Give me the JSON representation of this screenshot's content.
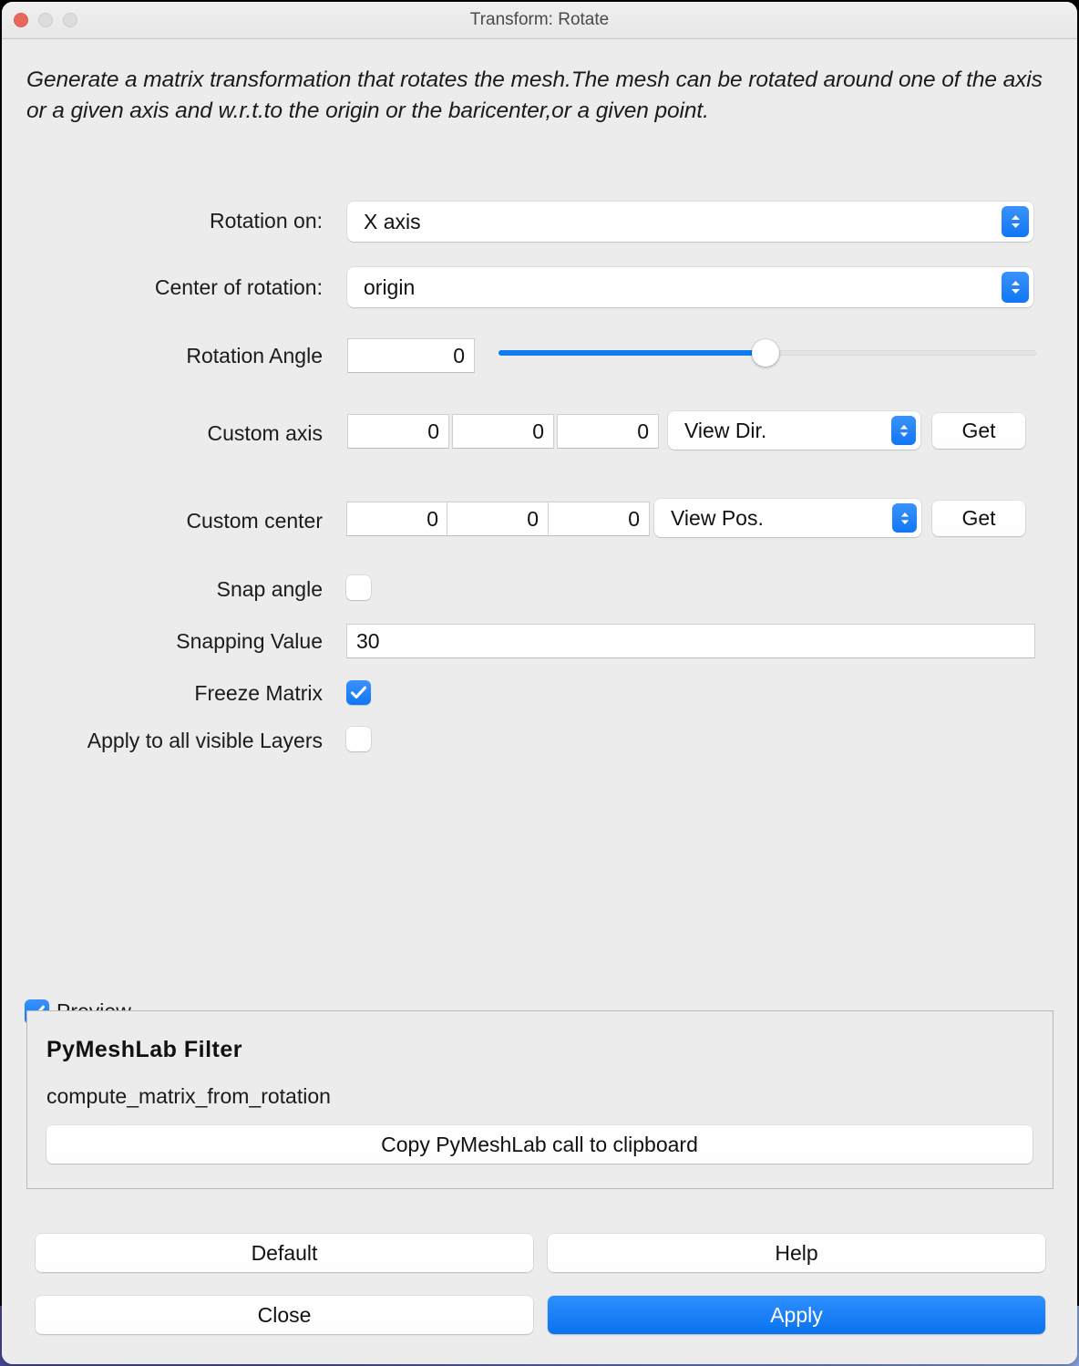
{
  "window": {
    "title": "Transform: Rotate",
    "traffic_lights": [
      {
        "name": "close",
        "color": "#e8695c"
      },
      {
        "name": "minimize",
        "color": "#dcdcdc"
      },
      {
        "name": "maximize",
        "color": "#dcdcdc"
      }
    ]
  },
  "description": "Generate a matrix transformation that rotates the mesh.The mesh can be rotated around one of the axis or a given axis and w.r.t.to the origin or the baricenter,or a given point.",
  "form": {
    "rotation_on": {
      "label": "Rotation on:",
      "value": "X axis"
    },
    "center_of_rotation": {
      "label": "Center of rotation:",
      "value": "origin"
    },
    "rotation_angle": {
      "label": "Rotation Angle",
      "value": "0",
      "slider_percent": 50
    },
    "custom_axis": {
      "label": "Custom axis",
      "x": "0",
      "y": "0",
      "z": "0",
      "preset": "View Dir.",
      "get_label": "Get"
    },
    "custom_center": {
      "label": "Custom center",
      "x": "0",
      "y": "0",
      "z": "0",
      "preset": "View Pos.",
      "get_label": "Get"
    },
    "snap_angle": {
      "label": "Snap angle",
      "checked": false
    },
    "snapping_value": {
      "label": "Snapping Value",
      "value": "30"
    },
    "freeze_matrix": {
      "label": "Freeze Matrix",
      "checked": true
    },
    "apply_to_all_visible_layers": {
      "label": "Apply to all visible Layers",
      "checked": false
    }
  },
  "preview": {
    "label": "Preview",
    "checked": true
  },
  "pymeshlab": {
    "group_title": "PyMeshLab Filter",
    "filter_name": "compute_matrix_from_rotation",
    "copy_button": "Copy PyMeshLab call to clipboard"
  },
  "buttons": {
    "default": "Default",
    "help": "Help",
    "close": "Close",
    "apply": "Apply"
  },
  "colors": {
    "accent": "#0a72f0",
    "window_bg": "#ececec",
    "close_button": "#e8695c"
  }
}
